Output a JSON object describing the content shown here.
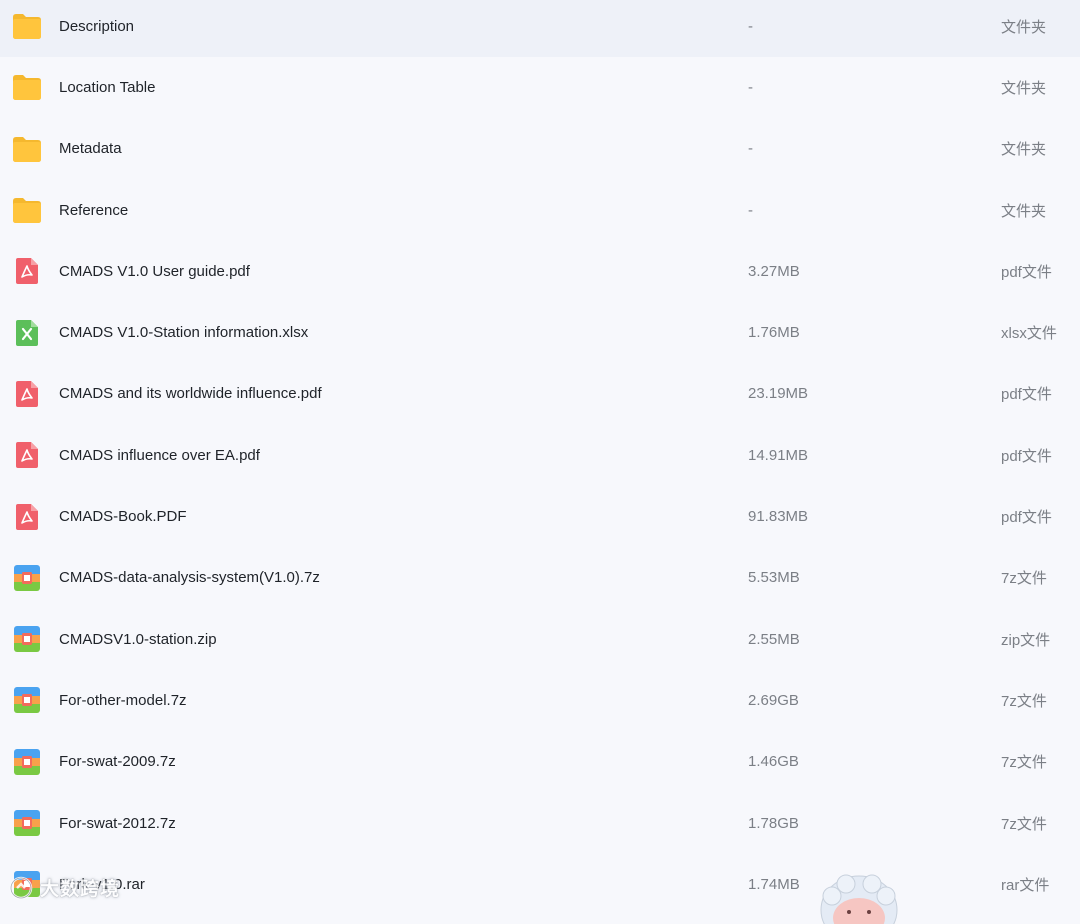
{
  "files": [
    {
      "name": "Description",
      "size": "-",
      "type": "文件夹",
      "icon": "folder-icon"
    },
    {
      "name": "Location Table",
      "size": "-",
      "type": "文件夹",
      "icon": "folder-icon"
    },
    {
      "name": "Metadata",
      "size": "-",
      "type": "文件夹",
      "icon": "folder-icon"
    },
    {
      "name": "Reference",
      "size": "-",
      "type": "文件夹",
      "icon": "folder-icon"
    },
    {
      "name": "CMADS V1.0 User guide.pdf",
      "size": "3.27MB",
      "type": "pdf文件",
      "icon": "pdf-icon"
    },
    {
      "name": "CMADS V1.0-Station information.xlsx",
      "size": "1.76MB",
      "type": "xlsx文件",
      "icon": "excel-icon"
    },
    {
      "name": "CMADS and its worldwide influence.pdf",
      "size": "23.19MB",
      "type": "pdf文件",
      "icon": "pdf-icon"
    },
    {
      "name": "CMADS influence over EA.pdf",
      "size": "14.91MB",
      "type": "pdf文件",
      "icon": "pdf-icon"
    },
    {
      "name": "CMADS-Book.PDF",
      "size": "91.83MB",
      "type": "pdf文件",
      "icon": "pdf-icon"
    },
    {
      "name": "CMADS-data-analysis-system(V1.0).7z",
      "size": "5.53MB",
      "type": "7z文件",
      "icon": "archive-icon"
    },
    {
      "name": "CMADSV1.0-station.zip",
      "size": "2.55MB",
      "type": "zip文件",
      "icon": "archive-icon"
    },
    {
      "name": "For-other-model.7z",
      "size": "2.69GB",
      "type": "7z文件",
      "icon": "archive-icon"
    },
    {
      "name": "For-swat-2009.7z",
      "size": "1.46GB",
      "type": "7z文件",
      "icon": "archive-icon"
    },
    {
      "name": "For-swat-2012.7z",
      "size": "1.78GB",
      "type": "7z文件",
      "icon": "archive-icon"
    },
    {
      "name": "Fork-v1.0.rar",
      "size": "1.74MB",
      "type": "rar文件",
      "icon": "archive-icon"
    }
  ],
  "watermark": {
    "text": "大数跨境",
    "icon": "logo-icon"
  },
  "colors": {
    "background": "#f7f8fc",
    "folder": "#ffc53d",
    "pdf": "#f0606b",
    "excel": "#5cbf5a",
    "archive_top": "#4aa3f0",
    "archive_bottom": "#7ac943",
    "archive_mid": "#f36b5b",
    "text_primary": "#1f2329",
    "text_secondary": "#7b7f86"
  }
}
